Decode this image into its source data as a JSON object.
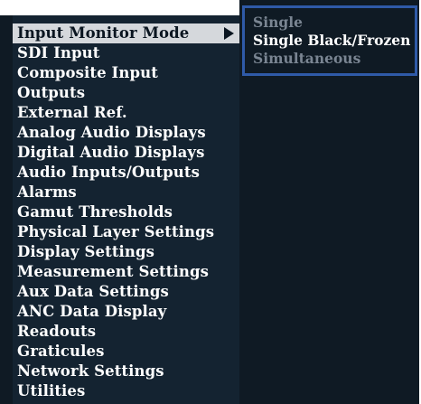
{
  "menu": {
    "items": [
      {
        "label": "Input Monitor Mode"
      },
      {
        "label": "SDI Input"
      },
      {
        "label": "Composite Input"
      },
      {
        "label": "Outputs"
      },
      {
        "label": "External Ref."
      },
      {
        "label": "Analog Audio Displays"
      },
      {
        "label": "Digital Audio Displays"
      },
      {
        "label": "Audio Inputs/Outputs"
      },
      {
        "label": "Alarms"
      },
      {
        "label": "Gamut Thresholds"
      },
      {
        "label": "Physical Layer Settings"
      },
      {
        "label": "Display Settings"
      },
      {
        "label": "Measurement Settings"
      },
      {
        "label": "Aux Data Settings"
      },
      {
        "label": "ANC Data Display"
      },
      {
        "label": "Readouts"
      },
      {
        "label": "Graticules"
      },
      {
        "label": "Network Settings"
      },
      {
        "label": "Utilities"
      }
    ],
    "selected_index": 0
  },
  "submenu": {
    "options": [
      {
        "label": "Single",
        "state": "dimmed"
      },
      {
        "label": "Single Black/Frozen",
        "state": "active"
      },
      {
        "label": "Simultaneous",
        "state": "dimmed"
      }
    ]
  },
  "colors": {
    "background": "#0f1a24",
    "menu_background": "#142331",
    "selected_highlight": "#d5d8dc",
    "submenu_border": "#2f5aa8",
    "dimmed_text": "#7a8592",
    "text": "#ffffff"
  },
  "icons": {
    "submenu_arrow": "triangle-right-icon"
  }
}
